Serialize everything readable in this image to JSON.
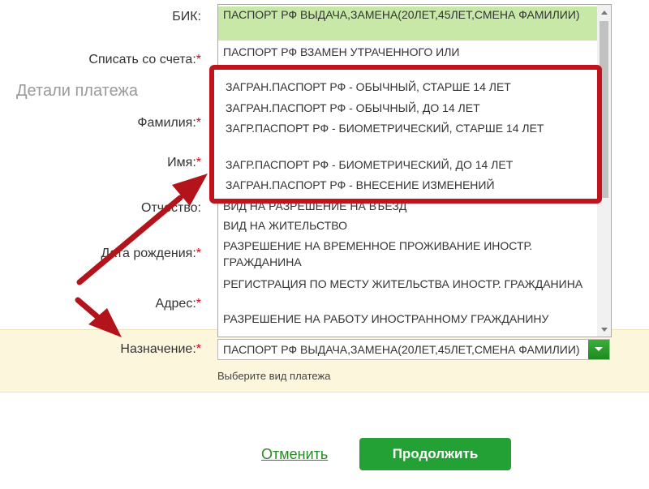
{
  "form": {
    "bik_label": "БИК:",
    "debit_label": "Списать со счета:",
    "section_title": "Детали платежа",
    "surname_label": "Фамилия:",
    "name_label": "Имя:",
    "patronymic_label": "Отчество:",
    "birthdate_label": "Дата рождения:",
    "address_label": "Адрес:",
    "purpose_label": "Назначение:",
    "required_mark": "*",
    "purpose_hint": "Выберите вид платежа"
  },
  "purpose_select": {
    "selected_value": "ПАСПОРТ РФ ВЫДАЧА,ЗАМЕНА(20ЛЕТ,45ЛЕТ,СМЕНА ФАМИЛИИ)"
  },
  "dropdown": {
    "options": [
      "ПАСПОРТ РФ ВЫДАЧА,ЗАМЕНА(20ЛЕТ,45ЛЕТ,СМЕНА ФАМИЛИИ)",
      "ПАСПОРТ РФ ВЗАМЕН УТРАЧЕННОГО ИЛИ",
      "ВИД НА РАЗРЕШЕНИЕ НА ВЪЕЗД",
      "ВИД НА ЖИТЕЛЬСТВО",
      "РАЗРЕШЕНИЕ НА ВРЕМЕННОЕ ПРОЖИВАНИЕ ИНОСТР. ГРАЖДАНИНА",
      "РЕГИСТРАЦИЯ ПО МЕСТУ ЖИТЕЛЬСТВА ИНОСТР. ГРАЖДАНИНА",
      "РАЗРЕШЕНИЕ НА РАБОТУ ИНОСТРАННОМУ ГРАЖДАНИНУ"
    ],
    "highlighted_options": [
      "ЗАГРАН.ПАСПОРТ РФ - ОБЫЧНЫЙ, СТАРШЕ 14 ЛЕТ",
      "ЗАГРАН.ПАСПОРТ РФ - ОБЫЧНЫЙ, ДО 14 ЛЕТ",
      "ЗАГР.ПАСПОРТ РФ - БИОМЕТРИЧЕСКИЙ, СТАРШЕ 14 ЛЕТ",
      "ЗАГР.ПАСПОРТ РФ - БИОМЕТРИЧЕСКИЙ, ДО 14 ЛЕТ",
      "ЗАГРАН.ПАСПОРТ РФ - ВНЕСЕНИЕ ИЗМЕНЕНИЙ"
    ]
  },
  "actions": {
    "cancel_label": "Отменить",
    "continue_label": "Продолжить"
  },
  "colors": {
    "accent_green": "#24a135",
    "selected_option": "#c7e8a7",
    "highlight_red": "#c0141c",
    "purpose_band": "#fcf6dd"
  }
}
